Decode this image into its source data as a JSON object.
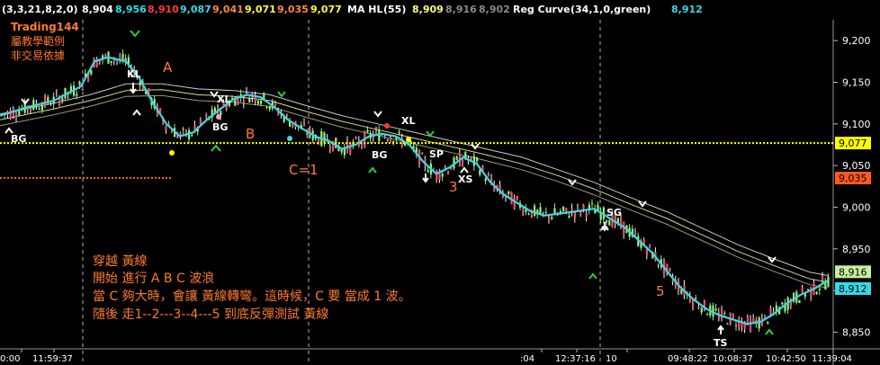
{
  "header": {
    "items": [
      {
        "text": "(3,3,21,8,2,0)",
        "color": "#ffffff"
      },
      {
        "text": "8,904",
        "color": "#ffffff"
      },
      {
        "text": "8,956",
        "color": "#39d8e6"
      },
      {
        "text": "8,910",
        "color": "#ff3b3b"
      },
      {
        "text": "9,087",
        "color": "#39d8e6"
      },
      {
        "text": "9,041",
        "color": "#ff8a3d"
      },
      {
        "text": "9,071",
        "color": "#ffff3b"
      },
      {
        "text": "9,035",
        "color": "#ff8a3d"
      },
      {
        "text": "9,077",
        "color": "#ffff3b"
      },
      {
        "text": "MA HL",
        "color": "#ffffff"
      },
      {
        "text": "(55)",
        "color": "#ffffff"
      },
      {
        "text": "8,909",
        "color": "#ffff80"
      },
      {
        "text": "8,916",
        "color": "#8a8a8a"
      },
      {
        "text": "8,902",
        "color": "#8a8a8a"
      },
      {
        "text": "Reg Curve",
        "color": "#ffffff"
      },
      {
        "text": "(34,1,0,green)",
        "color": "#ffffff"
      },
      {
        "text": "8,912",
        "color": "#39d8e6"
      }
    ]
  },
  "watermark": {
    "line1": "Trading144",
    "line2": "屬教學範例",
    "line3": "非交易依據"
  },
  "note": {
    "line1": "穿越 黃線",
    "line2": "開始 進行 A  B  C 波浪",
    "line3": "當 C  夠大時，會讓 黃線轉彎。這時候，C 要 當成 1 波。",
    "line4": "隨後 走1--2---3--4---5 到底反彈測試 黃線"
  },
  "wave_labels": {
    "a": "A",
    "b": "B",
    "c": "C=1",
    "three": "3",
    "five": "5"
  },
  "signals": {
    "bg1": "BG",
    "kl": "KL",
    "bg2": "BG",
    "xl1": "XL",
    "xl2": "XL",
    "bg3": "BG",
    "sp": "SP",
    "xs": "XS",
    "sg": "SG",
    "ts": "TS"
  },
  "chart_data": {
    "type": "candlestick",
    "y_ticks": [
      "9,200",
      "9,150",
      "9,100",
      "9,050",
      "9,000",
      "8,950",
      "8,900",
      "8,850"
    ],
    "ylim": [
      8830,
      9225
    ],
    "x_ticks": [
      "0:00",
      "11:59:37",
      ":04",
      "12:37:16",
      "10",
      "09:48:22",
      "10:08:37",
      "10:42:50",
      "11:39:04"
    ],
    "price_tags": [
      {
        "value": 9077,
        "label": "9,077",
        "bg": "#ffff00",
        "fg": "#000000"
      },
      {
        "value": 9035,
        "label": "9,035",
        "bg": "#ff5a1e",
        "fg": "#000000"
      },
      {
        "value": 8916,
        "label": "8,916",
        "bg": "#c6f0a0",
        "fg": "#000000"
      },
      {
        "value": 8912,
        "label": "8,912",
        "bg": "#39d8e6",
        "fg": "#000000"
      }
    ],
    "yellow_line": 9077,
    "orange_line": 9035,
    "reg_curve": [
      [
        0,
        9110
      ],
      [
        30,
        9120
      ],
      [
        60,
        9128
      ],
      [
        90,
        9145
      ],
      [
        105,
        9175
      ],
      [
        120,
        9180
      ],
      [
        140,
        9175
      ],
      [
        155,
        9155
      ],
      [
        170,
        9125
      ],
      [
        185,
        9100
      ],
      [
        200,
        9085
      ],
      [
        215,
        9090
      ],
      [
        230,
        9105
      ],
      [
        245,
        9118
      ],
      [
        260,
        9130
      ],
      [
        275,
        9135
      ],
      [
        290,
        9132
      ],
      [
        305,
        9120
      ],
      [
        320,
        9105
      ],
      [
        335,
        9095
      ],
      [
        350,
        9085
      ],
      [
        365,
        9080
      ],
      [
        380,
        9070
      ],
      [
        395,
        9075
      ],
      [
        410,
        9085
      ],
      [
        425,
        9088
      ],
      [
        440,
        9085
      ],
      [
        455,
        9075
      ],
      [
        470,
        9055
      ],
      [
        485,
        9040
      ],
      [
        500,
        9048
      ],
      [
        515,
        9060
      ],
      [
        530,
        9052
      ],
      [
        545,
        9030
      ],
      [
        560,
        9015
      ],
      [
        575,
        9005
      ],
      [
        590,
        8995
      ],
      [
        605,
        8990
      ],
      [
        620,
        8992
      ],
      [
        640,
        8995
      ],
      [
        660,
        8998
      ],
      [
        670,
        8992
      ],
      [
        680,
        8985
      ],
      [
        695,
        8975
      ],
      [
        710,
        8960
      ],
      [
        725,
        8945
      ],
      [
        740,
        8925
      ],
      [
        755,
        8905
      ],
      [
        770,
        8890
      ],
      [
        785,
        8878
      ],
      [
        800,
        8870
      ],
      [
        815,
        8865
      ],
      [
        830,
        8860
      ],
      [
        845,
        8862
      ],
      [
        860,
        8872
      ],
      [
        875,
        8885
      ],
      [
        890,
        8895
      ],
      [
        905,
        8902
      ],
      [
        920,
        8912
      ]
    ],
    "ma_high": [
      [
        0,
        9112
      ],
      [
        60,
        9125
      ],
      [
        100,
        9135
      ],
      [
        140,
        9148
      ],
      [
        180,
        9148
      ],
      [
        220,
        9142
      ],
      [
        260,
        9140
      ],
      [
        300,
        9135
      ],
      [
        340,
        9122
      ],
      [
        380,
        9110
      ],
      [
        420,
        9100
      ],
      [
        460,
        9090
      ],
      [
        500,
        9080
      ],
      [
        540,
        9070
      ],
      [
        580,
        9060
      ],
      [
        620,
        9045
      ],
      [
        660,
        9030
      ],
      [
        700,
        9012
      ],
      [
        740,
        8995
      ],
      [
        780,
        8975
      ],
      [
        820,
        8955
      ],
      [
        860,
        8938
      ],
      [
        900,
        8922
      ],
      [
        920,
        8918
      ]
    ],
    "ma_mid": [
      [
        0,
        9105
      ],
      [
        60,
        9118
      ],
      [
        100,
        9128
      ],
      [
        140,
        9140
      ],
      [
        180,
        9141
      ],
      [
        220,
        9135
      ],
      [
        260,
        9133
      ],
      [
        300,
        9128
      ],
      [
        340,
        9115
      ],
      [
        380,
        9103
      ],
      [
        420,
        9093
      ],
      [
        460,
        9083
      ],
      [
        500,
        9073
      ],
      [
        540,
        9063
      ],
      [
        580,
        9052
      ],
      [
        620,
        9038
      ],
      [
        660,
        9022
      ],
      [
        700,
        9004
      ],
      [
        740,
        8987
      ],
      [
        780,
        8967
      ],
      [
        820,
        8947
      ],
      [
        860,
        8930
      ],
      [
        900,
        8914
      ],
      [
        920,
        8910
      ]
    ],
    "ma_low": [
      [
        0,
        9098
      ],
      [
        60,
        9111
      ],
      [
        100,
        9121
      ],
      [
        140,
        9133
      ],
      [
        180,
        9134
      ],
      [
        220,
        9128
      ],
      [
        260,
        9126
      ],
      [
        300,
        9121
      ],
      [
        340,
        9108
      ],
      [
        380,
        9096
      ],
      [
        420,
        9086
      ],
      [
        460,
        9076
      ],
      [
        500,
        9066
      ],
      [
        540,
        9056
      ],
      [
        580,
        9045
      ],
      [
        620,
        9031
      ],
      [
        660,
        9015
      ],
      [
        700,
        8997
      ],
      [
        740,
        8980
      ],
      [
        780,
        8960
      ],
      [
        820,
        8940
      ],
      [
        860,
        8923
      ],
      [
        900,
        8907
      ],
      [
        920,
        8903
      ]
    ]
  }
}
